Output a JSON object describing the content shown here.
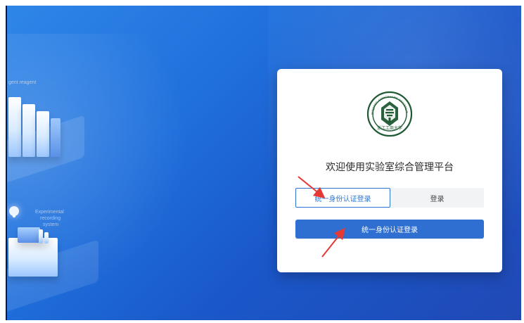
{
  "left_illustrations": {
    "top_label": "gent reagent",
    "bottom_label_lines": [
      "Experimental",
      "recording",
      "system"
    ]
  },
  "card": {
    "logo": {
      "semantic": "university-seal",
      "name_en": "ZHEJIANG GONGSHANG UNIVERSITY",
      "year": "1911",
      "name_cn_calligraphy": "浙江工商大学"
    },
    "title": "欢迎使用实验室综合管理平台",
    "tabs": [
      {
        "label": "统一身份认证登录",
        "active": true
      },
      {
        "label": "登录",
        "active": false
      }
    ],
    "primary_button_label": "统一身份认证登录"
  },
  "colors": {
    "background_blue": "#1f6fdc",
    "accent_blue": "#2f74d0",
    "button_blue": "#2f6fd1",
    "annotation_red": "#e53935"
  }
}
